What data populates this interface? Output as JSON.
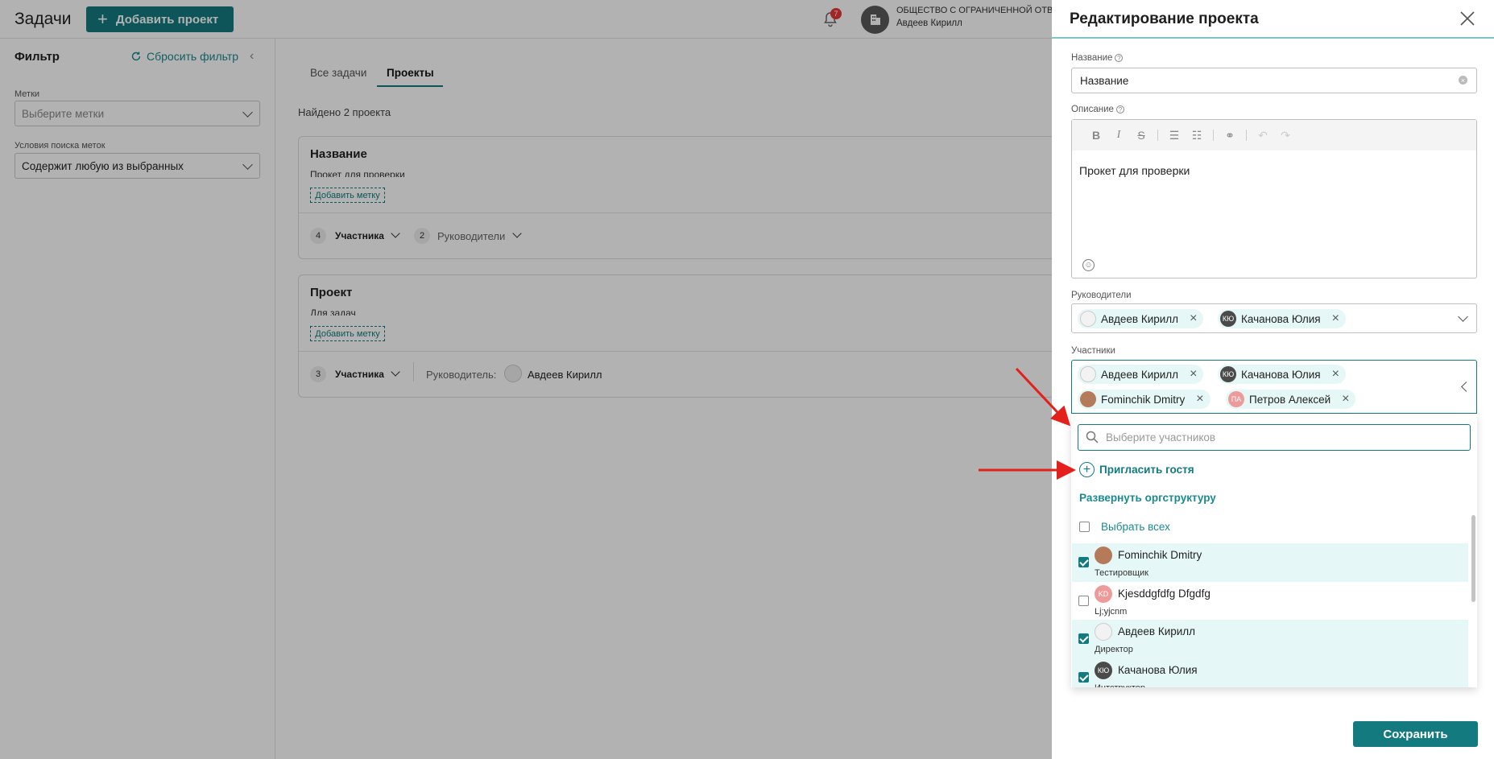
{
  "header": {
    "title": "Задачи",
    "add_project_label": "Добавить проект",
    "notifications_count": "7",
    "org_name": "ОБЩЕСТВО С ОГРАНИЧЕННОЙ ОТВЕ",
    "user_name": "Авдеев Кирилл"
  },
  "filter": {
    "title": "Фильтр",
    "reset_label": "Сбросить фильтр",
    "tags_label": "Метки",
    "tags_placeholder": "Выберите метки",
    "condition_label": "Условия поиска меток",
    "condition_value": "Содержит любую из выбранных"
  },
  "tabs": [
    {
      "label": "Все задачи",
      "active": false
    },
    {
      "label": "Проекты",
      "active": true
    }
  ],
  "found_text": "Найдено 2 проекта",
  "projects": [
    {
      "title": "Название",
      "description": "Прокет для проверки",
      "add_tag_label": "Добавить метку",
      "members_count": "4",
      "members_label": "Участника",
      "leaders_count": "2",
      "leaders_label": "Руководители"
    },
    {
      "title": "Проект",
      "description": "Для задач",
      "add_tag_label": "Добавить метку",
      "members_count": "3",
      "members_label": "Участника",
      "leader_label": "Руководитель:",
      "leader_name": "Авдеев Кирилл"
    }
  ],
  "panel": {
    "title": "Редактирование проекта",
    "name_label": "Название",
    "name_value": "Название",
    "description_label": "Описание",
    "description_value": "Прокет для проверки",
    "leaders_label": "Руководители",
    "leaders": [
      {
        "name": "Авдеев Кирилл",
        "avatar": "avatar-light",
        "initials": ""
      },
      {
        "name": "Качанова Юлия",
        "avatar": "avatar-dark",
        "initials": "КЮ"
      }
    ],
    "members_label": "Участники",
    "members": [
      {
        "name": "Авдеев Кирилл",
        "avatar": "avatar-light",
        "initials": ""
      },
      {
        "name": "Качанова Юлия",
        "avatar": "avatar-dark",
        "initials": "КЮ"
      },
      {
        "name": "Fominchik Dmitry",
        "avatar": "avatar-photo",
        "initials": ""
      },
      {
        "name": "Петров Алексей",
        "avatar": "avatar-pink",
        "initials": "ПА"
      }
    ],
    "dropdown": {
      "search_placeholder": "Выберите участников",
      "invite_label": "Пригласить гостя",
      "expand_label": "Развернуть оргструктуру",
      "select_all_label": "Выбрать всех",
      "options": [
        {
          "name": "Fominchik Dmitry",
          "role": "Тестировщик",
          "checked": true,
          "initials": "",
          "avatar": "avatar-photo"
        },
        {
          "name": "Kjesddgfdfg Dfgdfg",
          "role": "Lj;yjcnm",
          "checked": false,
          "initials": "KD",
          "avatar": "avatar-pink"
        },
        {
          "name": "Авдеев Кирилл",
          "role": "Директор",
          "checked": true,
          "initials": "",
          "avatar": "avatar-light"
        },
        {
          "name": "Качанова Юлия",
          "role": "Интструктор",
          "checked": true,
          "initials": "КЮ",
          "avatar": "avatar-dark"
        }
      ]
    },
    "save_label": "Сохранить"
  },
  "colors": {
    "accent": "#137a80",
    "accent_light": "#e6f7f7",
    "badge": "#e53935",
    "annotation_arrow": "#e3201b"
  }
}
